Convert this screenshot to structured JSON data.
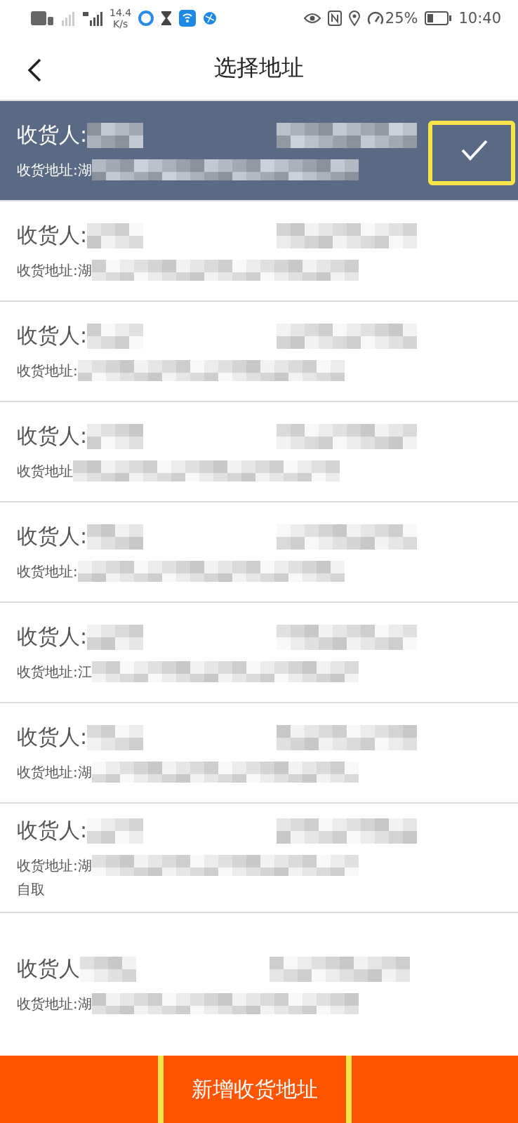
{
  "status_bar": {
    "network_speed": "14.4",
    "speed_unit": "K/s",
    "battery": "25%",
    "time": "10:40"
  },
  "header": {
    "title": "选择地址"
  },
  "addresses": [
    {
      "recipient_label": "收货人:",
      "address_label": "收货地址:湖",
      "selected": true,
      "highlighted": true
    },
    {
      "recipient_label": "收货人:",
      "address_label": "收货地址:湖",
      "selected": false,
      "highlighted": false
    },
    {
      "recipient_label": "收货人:",
      "address_label": "收货地址:",
      "selected": false,
      "highlighted": false
    },
    {
      "recipient_label": "收货人:",
      "address_label": "收货地址",
      "selected": false,
      "highlighted": false
    },
    {
      "recipient_label": "收货人:",
      "address_label": "收货地址:",
      "selected": false,
      "highlighted": false
    },
    {
      "recipient_label": "收货人:",
      "address_label": "收货地址:江",
      "selected": false,
      "highlighted": false
    },
    {
      "recipient_label": "收货人:",
      "address_label": "收货地址:湖",
      "selected": false,
      "highlighted": false
    },
    {
      "recipient_label": "收货人:",
      "address_label": "收货地址:湖",
      "extra_line": "自取",
      "selected": false,
      "highlighted": false
    },
    {
      "recipient_label": "收货人",
      "address_label": "收货地址:湖",
      "selected": false,
      "highlighted": false
    }
  ],
  "add_button": {
    "label": "新增收货地址",
    "highlighted": true
  }
}
